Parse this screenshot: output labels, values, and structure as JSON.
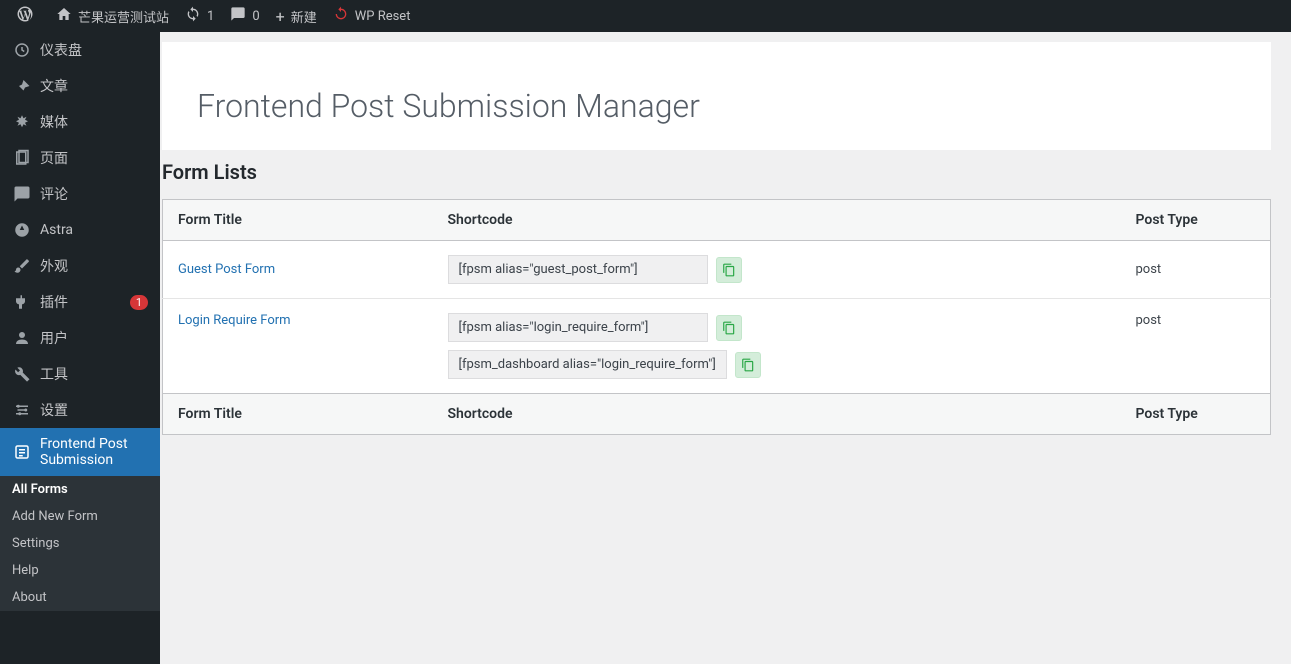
{
  "admin_bar": {
    "site_name": "芒果运营测试站",
    "updates_count": "1",
    "comments_count": "0",
    "new_label": "新建",
    "wpreset_label": "WP Reset"
  },
  "sidebar": {
    "items": [
      {
        "icon": "dashboard",
        "label": "仪表盘"
      },
      {
        "icon": "pin",
        "label": "文章"
      },
      {
        "icon": "media",
        "label": "媒体"
      },
      {
        "icon": "page",
        "label": "页面"
      },
      {
        "icon": "comment",
        "label": "评论"
      },
      {
        "icon": "astra",
        "label": "Astra"
      },
      {
        "icon": "appearance",
        "label": "外观"
      },
      {
        "icon": "plugin",
        "label": "插件",
        "badge": "1"
      },
      {
        "icon": "user",
        "label": "用户"
      },
      {
        "icon": "tool",
        "label": "工具"
      },
      {
        "icon": "settings",
        "label": "设置"
      },
      {
        "icon": "form",
        "label": "Frontend Post Submission",
        "current": true
      }
    ],
    "submenu": [
      {
        "label": "All Forms",
        "current": true
      },
      {
        "label": "Add New Form"
      },
      {
        "label": "Settings"
      },
      {
        "label": "Help"
      },
      {
        "label": "About"
      }
    ]
  },
  "page": {
    "title": "Frontend Post Submission Manager",
    "section_title": "Form Lists",
    "table": {
      "headers": {
        "title": "Form Title",
        "shortcode": "Shortcode",
        "posttype": "Post Type"
      },
      "rows": [
        {
          "title": "Guest Post Form",
          "shortcodes": [
            "[fpsm alias=\"guest_post_form\"]"
          ],
          "posttype": "post"
        },
        {
          "title": "Login Require Form",
          "shortcodes": [
            "[fpsm alias=\"login_require_form\"]",
            "[fpsm_dashboard alias=\"login_require_form\"]"
          ],
          "posttype": "post"
        }
      ]
    }
  }
}
